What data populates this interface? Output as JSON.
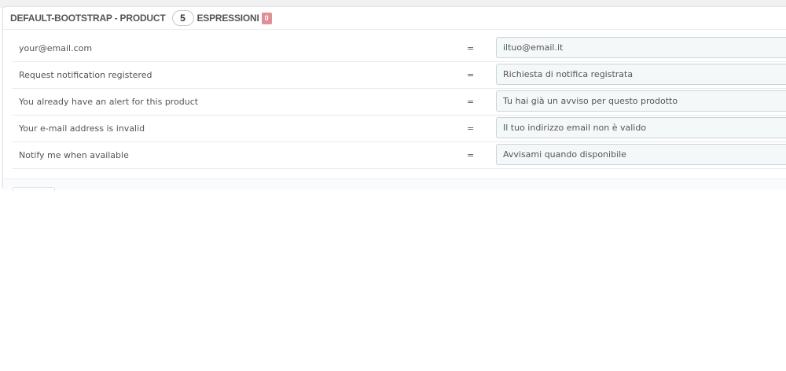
{
  "header": {
    "title": "DEFAULT-BOOTSTRAP - PRODUCT",
    "count": "5",
    "expressions_label": "ESPRESSIONI",
    "expressions_missing": "0"
  },
  "rows": [
    {
      "source": "your@email.com",
      "equals": "=",
      "translation": "iltuo@email.it"
    },
    {
      "source": "Request notification registered",
      "equals": "=",
      "translation": "Richiesta di notifica registrata"
    },
    {
      "source": "You already have an alert for this product",
      "equals": "=",
      "translation": "Tu hai già un avviso per questo prodotto"
    },
    {
      "source": "Your e-mail address is invalid",
      "equals": "=",
      "translation": "Il tuo indirizzo email non è valido"
    },
    {
      "source": "Notify me when available",
      "equals": "=",
      "translation": "Avvisami quando disponibile"
    }
  ],
  "colors": {
    "missing_badge": "#e08f95",
    "input_background": "#f5f8f9",
    "input_border": "#c7d6db"
  }
}
